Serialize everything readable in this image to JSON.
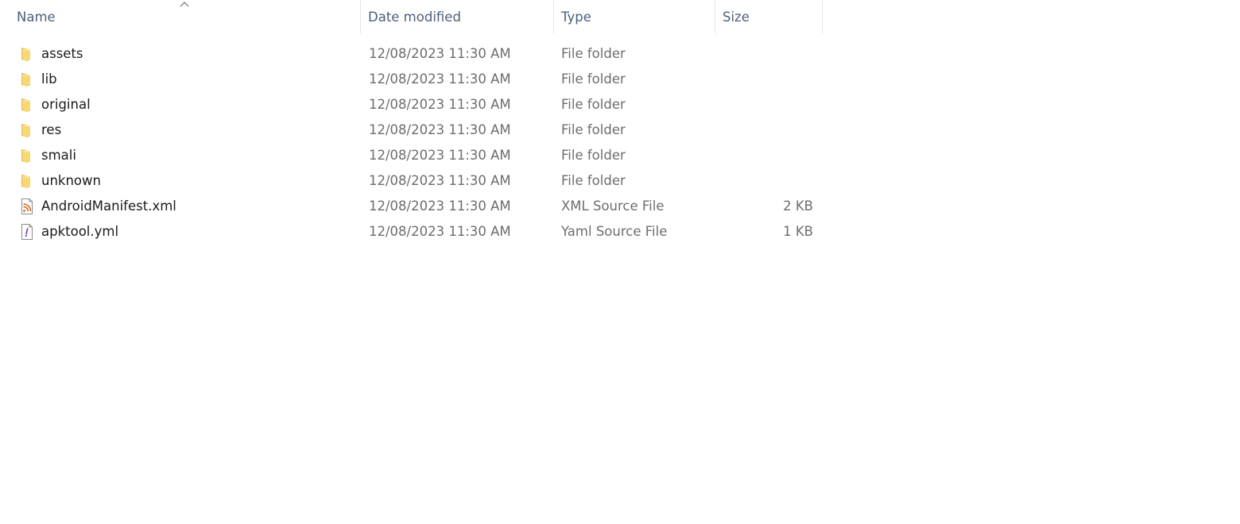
{
  "columns": {
    "name": "Name",
    "date_modified": "Date modified",
    "type": "Type",
    "size": "Size"
  },
  "sort": {
    "column": "name",
    "direction": "ascending"
  },
  "files": [
    {
      "name": "assets",
      "date": "12/08/2023 11:30 AM",
      "type": "File folder",
      "size": "",
      "icon": "folder-icon"
    },
    {
      "name": "lib",
      "date": "12/08/2023 11:30 AM",
      "type": "File folder",
      "size": "",
      "icon": "folder-icon"
    },
    {
      "name": "original",
      "date": "12/08/2023 11:30 AM",
      "type": "File folder",
      "size": "",
      "icon": "folder-icon"
    },
    {
      "name": "res",
      "date": "12/08/2023 11:30 AM",
      "type": "File folder",
      "size": "",
      "icon": "folder-icon"
    },
    {
      "name": "smali",
      "date": "12/08/2023 11:30 AM",
      "type": "File folder",
      "size": "",
      "icon": "folder-icon"
    },
    {
      "name": "unknown",
      "date": "12/08/2023 11:30 AM",
      "type": "File folder",
      "size": "",
      "icon": "folder-icon"
    },
    {
      "name": "AndroidManifest.xml",
      "date": "12/08/2023 11:30 AM",
      "type": "XML Source File",
      "size": "2 KB",
      "icon": "xml-file-icon"
    },
    {
      "name": "apktool.yml",
      "date": "12/08/2023 11:30 AM",
      "type": "Yaml Source File",
      "size": "1 KB",
      "icon": "yaml-file-icon"
    }
  ],
  "colors": {
    "header_text": "#4c607a",
    "name_text": "#1a1a1a",
    "meta_text": "#6d6d6d",
    "folder": "#f8d775",
    "xml_accent": "#d2691e",
    "yaml_accent": "#7a3fb0"
  }
}
